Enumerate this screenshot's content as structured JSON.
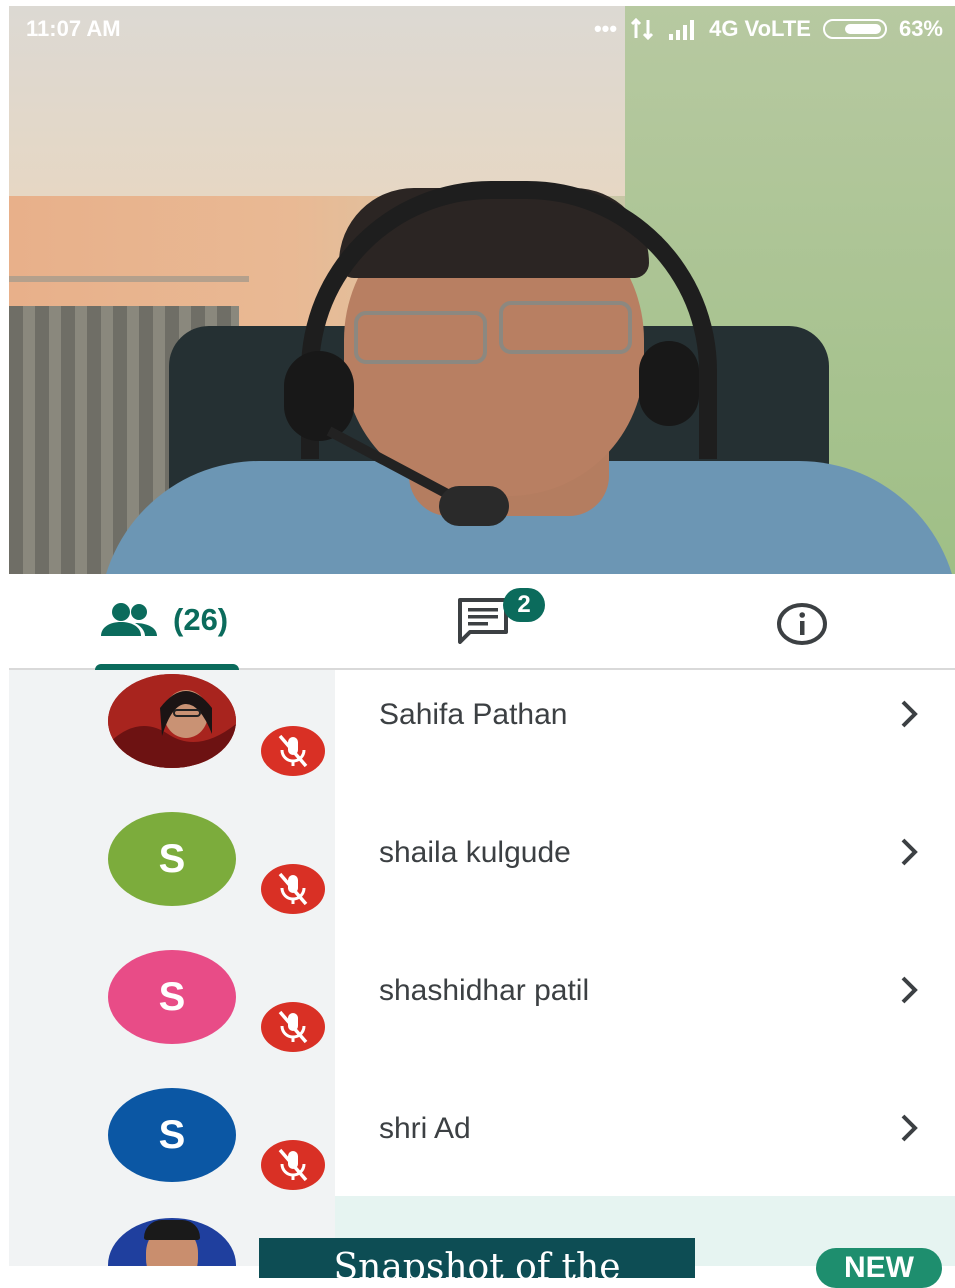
{
  "status_bar": {
    "time": "11:07 AM",
    "network": "4G VoLTE",
    "battery": "63%",
    "battery_level": 0.63,
    "icons": [
      "more-dots-icon",
      "data-arrows-icon",
      "signal-icon",
      "battery-icon"
    ]
  },
  "tabs": {
    "people_count": "(26)",
    "chat_badge": "2",
    "people_icon": "people-icon",
    "chat_icon": "chat-icon",
    "info_icon": "info-icon",
    "accent_color": "#0b6b5c"
  },
  "participants": [
    {
      "name": "Sahifa Pathan",
      "initial": "",
      "avatar_color": "#9e1f1f",
      "muted": true
    },
    {
      "name": "shaila kulgude",
      "initial": "S",
      "avatar_color": "#7cac3c",
      "muted": true
    },
    {
      "name": "shashidhar patil",
      "initial": "S",
      "avatar_color": "#e84c87",
      "muted": true
    },
    {
      "name": "shri Ad",
      "initial": "S",
      "avatar_color": "#0b57a4",
      "muted": true
    }
  ],
  "overlay": {
    "toast_text": "Snapshot of the",
    "new_label": "NEW"
  },
  "colors": {
    "mute_red": "#d93025",
    "highlight": "#e6f4f1"
  }
}
